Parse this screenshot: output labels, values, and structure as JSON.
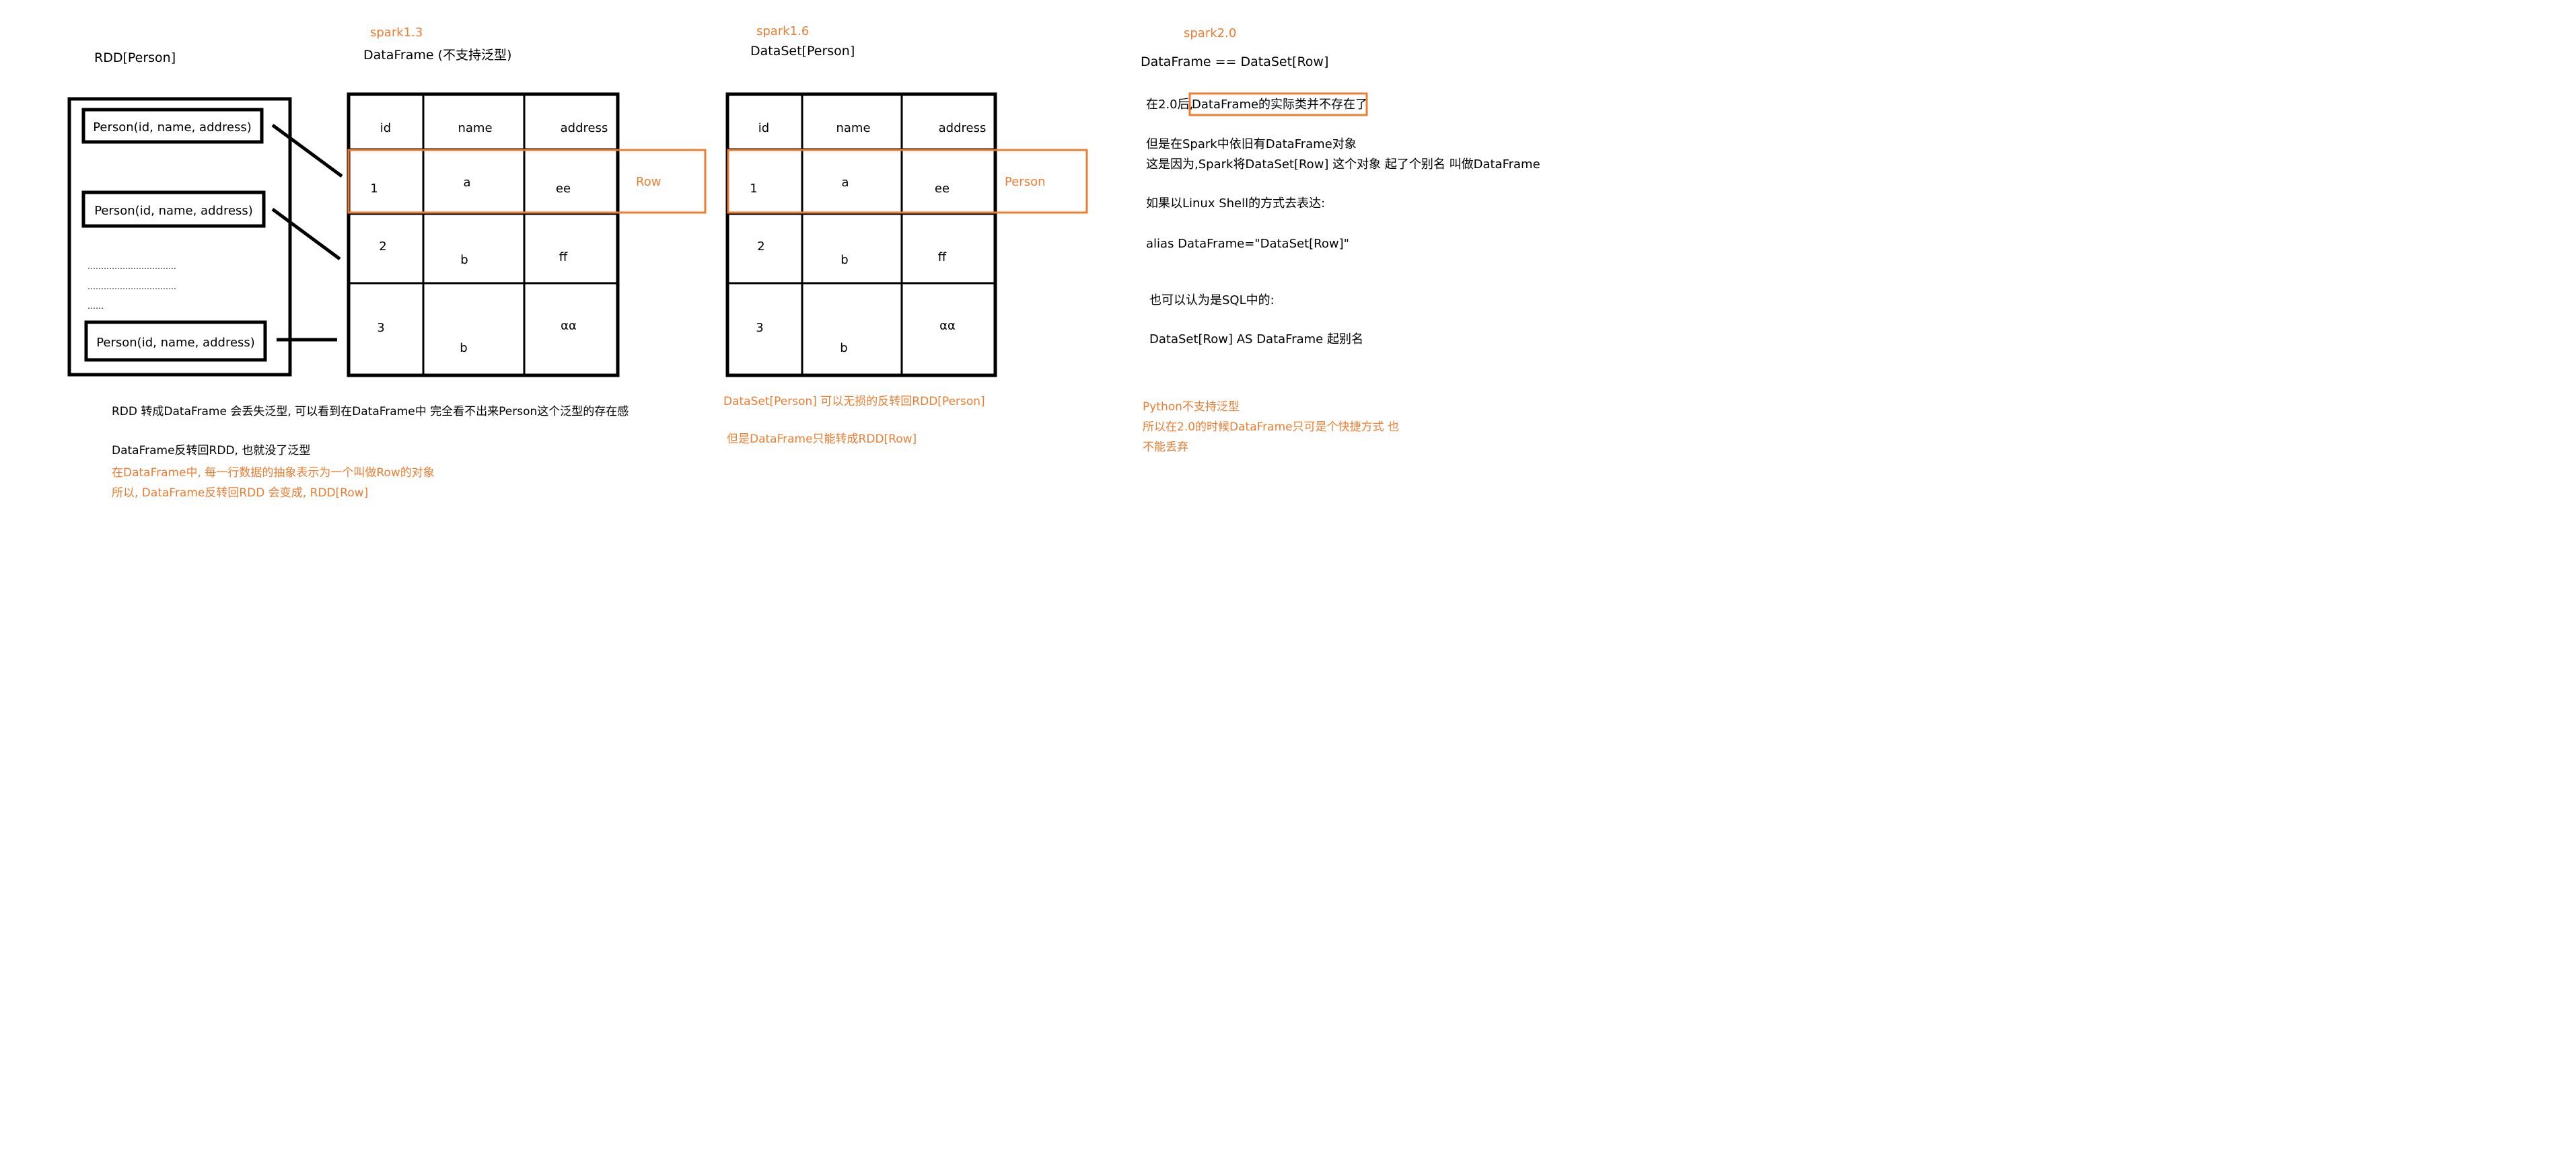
{
  "colors": {
    "text": "#000000",
    "accent": "#ED7D31",
    "background": "#FFFFFF"
  },
  "rdd": {
    "title": "RDD[Person]",
    "items": [
      "Person(id, name, address)",
      "Person(id, name, address)",
      "Person(id, name, address)"
    ],
    "dots": [
      "……………………………",
      "……………………………",
      "……"
    ],
    "notes": [
      "RDD 转成DataFrame 会丢失泛型, 可以看到在DataFrame中 完全看不出来Person这个泛型的存在感",
      "DataFrame反转回RDD, 也就没了泛型"
    ],
    "notes_accent": [
      "在DataFrame中, 每一行数据的抽象表示为一个叫做Row的对象",
      "所以, DataFrame反转回RDD 会变成, RDD[Row]"
    ]
  },
  "spark13": {
    "version": "spark1.3",
    "title": "DataFrame (不支持泛型)",
    "headers": [
      "id",
      "name",
      "address"
    ],
    "rows": [
      [
        "1",
        "a",
        "ee"
      ],
      [
        "2",
        "b",
        "ff"
      ],
      [
        "3",
        "b",
        "αα"
      ]
    ],
    "row_label": "Row"
  },
  "spark16": {
    "version": "spark1.6",
    "title": "DataSet[Person]",
    "headers": [
      "id",
      "name",
      "address"
    ],
    "rows": [
      [
        "1",
        "a",
        "ee"
      ],
      [
        "2",
        "b",
        "ff"
      ],
      [
        "3",
        "b",
        "αα"
      ]
    ],
    "row_label": "Person",
    "notes": [
      "DataSet[Person] 可以无损的反转回RDD[Person]",
      "但是DataFrame只能转成RDD[Row]"
    ]
  },
  "spark20": {
    "version": "spark2.0",
    "title": "DataFrame  == DataSet[Row]",
    "line1_prefix": "在2.0后,",
    "line1_boxed": "DataFrame的实际类并不存在了",
    "lines": [
      "但是在Spark中依旧有DataFrame对象",
      "这是因为,Spark将DataSet[Row] 这个对象 起了个别名 叫做DataFrame",
      "如果以Linux Shell的方式去表达:",
      "alias DataFrame=\"DataSet[Row]\"",
      "也可以认为是SQL中的:",
      "DataSet[Row]  AS DataFrame     起别名"
    ],
    "notes_accent": [
      "Python不支持泛型",
      "所以在2.0的时候DataFrame只可是个快捷方式 也",
      "不能丢弃"
    ]
  }
}
